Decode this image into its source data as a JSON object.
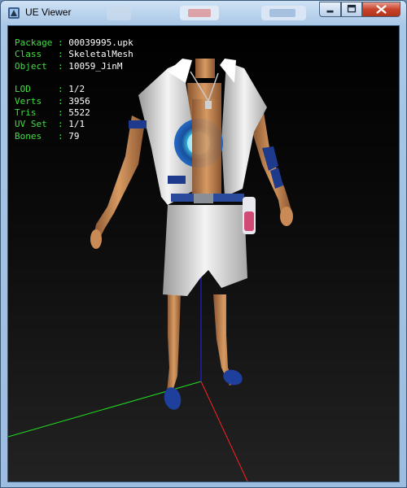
{
  "window": {
    "title": "UE Viewer"
  },
  "info": {
    "group1": [
      {
        "label": "Package",
        "value": "00039995.upk"
      },
      {
        "label": "Class  ",
        "value": "SkeletalMesh"
      },
      {
        "label": "Object ",
        "value": "10059_JinM"
      }
    ],
    "group2": [
      {
        "label": "LOD    ",
        "value": "1/2"
      },
      {
        "label": "Verts  ",
        "value": "3956"
      },
      {
        "label": "Tris   ",
        "value": "5522"
      },
      {
        "label": "UV Set ",
        "value": "1/1"
      },
      {
        "label": "Bones  ",
        "value": "79"
      }
    ]
  },
  "colors": {
    "label_green": "#3fe03f",
    "value_white": "#ffffff",
    "axis_x": "#ff2020",
    "axis_y": "#20e020",
    "axis_z": "#2020ff"
  },
  "icons": [
    "app-icon",
    "minimize-icon",
    "maximize-icon",
    "close-icon"
  ]
}
